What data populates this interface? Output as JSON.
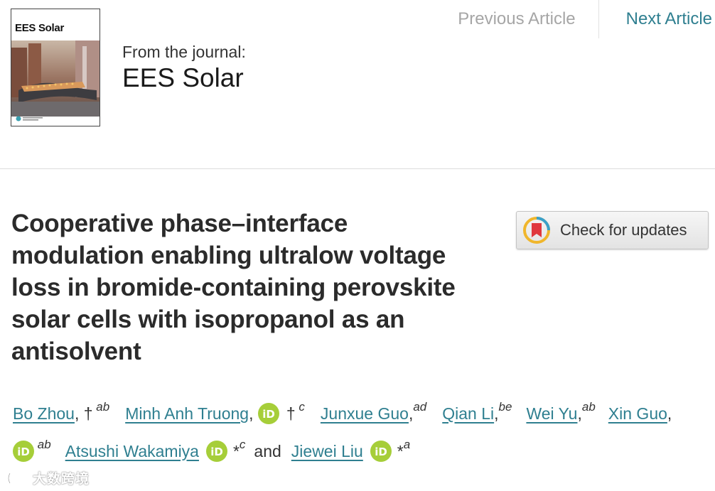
{
  "nav": {
    "previous_label": "Previous Article",
    "next_label": "Next Article"
  },
  "journal": {
    "cover_title": "EES Solar",
    "from_label": "From the journal:",
    "name": "EES Solar"
  },
  "article": {
    "title": "Cooperative phase–interface modulation enabling ultralow voltage loss in bromide-containing perovskite solar cells with isopropanol as an antisolvent"
  },
  "check_for_updates": {
    "label": "Check for updates"
  },
  "authors": [
    {
      "name": "Bo Zhou",
      "marks": "†",
      "affil": "ab",
      "orcid": false
    },
    {
      "name": "Minh Anh Truong",
      "marks": "†",
      "affil": "c",
      "orcid": true
    },
    {
      "name": "Junxue Guo",
      "marks": "",
      "affil": "ad",
      "orcid": false
    },
    {
      "name": "Qian Li",
      "marks": "",
      "affil": "be",
      "orcid": false
    },
    {
      "name": "Wei Yu",
      "marks": "",
      "affil": "ab",
      "orcid": false
    },
    {
      "name": "Xin Guo",
      "marks": "",
      "affil": "ab",
      "orcid": true
    },
    {
      "name": "Atsushi Wakamiya",
      "marks": "*",
      "affil": "c",
      "orcid": true
    },
    {
      "name": "Jiewei Liu",
      "marks": "*",
      "affil": "a",
      "orcid": true
    }
  ],
  "authors_conjunction": "and",
  "watermark": {
    "text": "大数跨境"
  },
  "colors": {
    "link": "#2f7f90",
    "orcid": "#a6ce39",
    "nav_inactive": "#a6a6a6"
  },
  "icons": {
    "orcid": "orcid-icon",
    "crossmark": "crossmark-icon"
  }
}
